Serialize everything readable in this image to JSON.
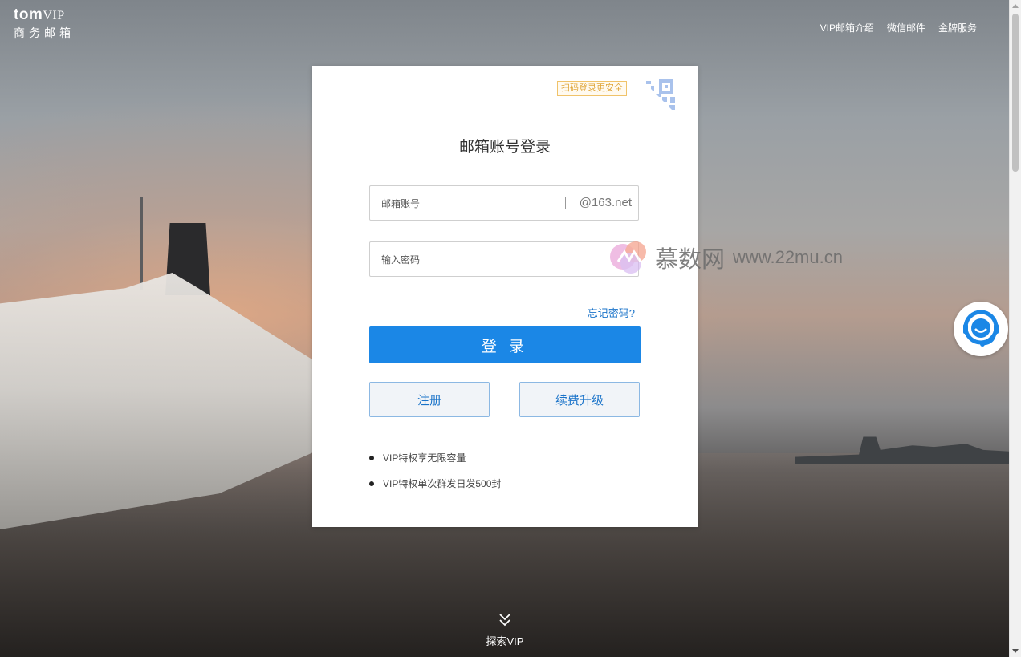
{
  "brand": {
    "name": "tom",
    "tag": "VIP",
    "subtitle": "商务邮箱"
  },
  "topnav": {
    "items": [
      {
        "label": "VIP邮箱介绍"
      },
      {
        "label": "微信邮件"
      },
      {
        "label": "金牌服务"
      }
    ]
  },
  "login": {
    "qr_tip": "扫码登录更安全",
    "title": "邮箱账号登录",
    "account_placeholder": "邮箱账号",
    "account_suffix": "@163.net",
    "password_placeholder": "输入密码",
    "forgot_label": "忘记密码?",
    "login_button": "登 录",
    "register_button": "注册",
    "renew_button": "续费升级",
    "features": [
      "VIP特权享无限容量",
      "VIP特权单次群发日发500封"
    ]
  },
  "watermark": {
    "cn": "慕数网",
    "url": "www.22mu.cn"
  },
  "explore": {
    "label": "探索VIP"
  },
  "colors": {
    "primary": "#1b87e6",
    "link": "#1a73c9",
    "qr_tip_border": "#f0c36a",
    "qr_icon": "#b9cef0"
  },
  "icons": {
    "qr": "qr-code-icon",
    "support": "customer-service-icon",
    "explore": "double-chevron-down-icon"
  }
}
